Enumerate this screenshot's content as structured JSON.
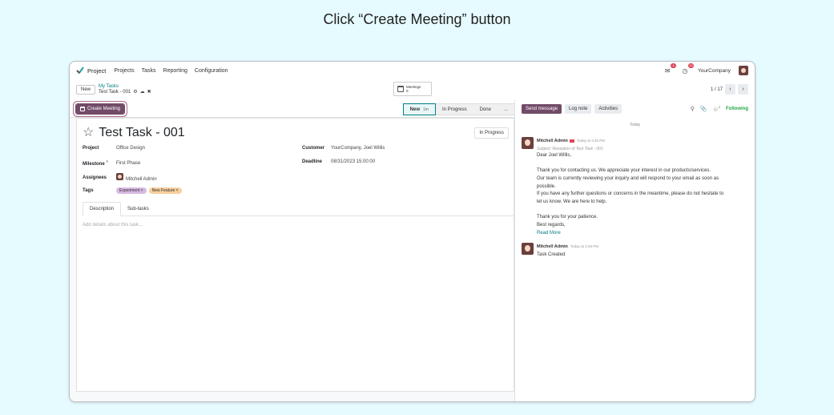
{
  "instruction": "Click “Create Meeting” button",
  "navbar": {
    "app_name": "Project",
    "menu": [
      "Projects",
      "Tasks",
      "Reporting",
      "Configuration"
    ],
    "chat_badge": "4",
    "activity_badge": "12",
    "company": "YourCompany"
  },
  "control_panel": {
    "new_label": "New",
    "breadcrumb_parent": "My Tasks",
    "breadcrumb_current": "Test Task - 001",
    "meetings_label": "Meetings",
    "meetings_count": "0",
    "pager": "1 / 17"
  },
  "statusbar": {
    "create_meeting_label": "Create Meeting",
    "stages": [
      {
        "label": "New",
        "time": "1m"
      },
      {
        "label": "In Progress"
      },
      {
        "label": "Done"
      },
      {
        "label": "..."
      }
    ]
  },
  "form": {
    "title": "Test Task - 001",
    "status_tag": "In Progress",
    "project_label": "Project",
    "project_value": "Office Design",
    "milestone_label": "Milestone",
    "milestone_sup": "?",
    "milestone_value": "First Phase",
    "assignees_label": "Assignees",
    "assignee_value": "Mitchell Admin",
    "tags_label": "Tags",
    "tags": [
      "Experiment",
      "New Feature"
    ],
    "customer_label": "Customer",
    "customer_value": "YourCompany, Joel Willis",
    "deadline_label": "Deadline",
    "deadline_value": "08/31/2023 15:00:00",
    "tab_description": "Description",
    "tab_subtasks": "Sub-tasks",
    "description_placeholder": "Add details about this task..."
  },
  "chatter": {
    "send_message": "Send message",
    "log_note": "Log note",
    "activities": "Activities",
    "followers_count": "2",
    "following": "Following",
    "date_separator": "Today",
    "messages": [
      {
        "author": "Mitchell Admin",
        "time": "Today at 3:35 PM",
        "subject": "Subject: Reception of Test Task - 001",
        "lines": [
          "Dear Joel Willis,",
          "",
          "Thank you for contacting us. We appreciate your interest in our products/services.",
          "Our team is currently reviewing your inquiry and will respond to your email as soon as",
          "possible.",
          "If you have any further questions or concerns in the meantime, please do not hesitate to",
          "let us know. We are here to help.",
          "",
          "Thank you for your patience.",
          "Best regards,"
        ],
        "read_more": "Read More"
      },
      {
        "author": "Mitchell Admin",
        "time": "Today at 3:35 PM",
        "body": "Task Created"
      }
    ]
  }
}
